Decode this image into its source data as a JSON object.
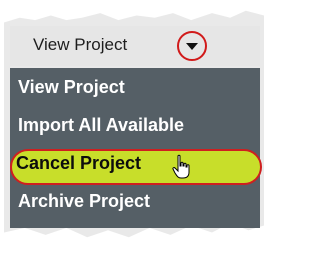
{
  "header": {
    "title": "View Project",
    "toggle_icon": "chevron-down-icon"
  },
  "menu": {
    "items": [
      {
        "label": "View Project"
      },
      {
        "label": "Import All Available"
      },
      {
        "label": "Cancel Project",
        "highlighted": true
      },
      {
        "label": "Archive Project"
      }
    ]
  },
  "colors": {
    "menu_background": "#555f66",
    "highlight_fill": "#c8de2a",
    "annotation_red": "#cf1f1f"
  }
}
